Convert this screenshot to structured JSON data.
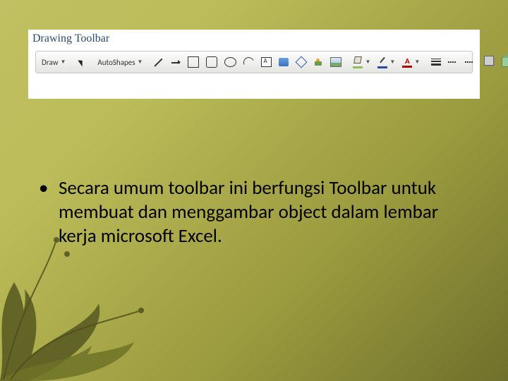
{
  "panel": {
    "title": "Drawing Toolbar"
  },
  "toolbar": {
    "draw_label": "Draw",
    "autoshapes_label": "AutoShapes",
    "icons": {
      "cursor": "select-cursor",
      "line": "line",
      "arrow": "arrow",
      "rect": "rectangle",
      "roundrect": "rounded-rectangle",
      "ellipse": "ellipse",
      "arc": "arc",
      "textbox": "text-box",
      "wordart": "word-art",
      "diagram": "diagram",
      "clipart": "clip-art",
      "picture": "picture",
      "fillcolor": "fill-color",
      "linecolor": "line-color",
      "fontcolor": "font-color",
      "lineweight": "line-weight",
      "dash": "dash-style",
      "arrowstyle": "arrow-style",
      "shadow": "shadow",
      "threeD": "3d"
    },
    "colors": {
      "fill_swatch": "#8fbf5f",
      "line_swatch": "#2b4aa0",
      "font_swatch": "#b00000"
    }
  },
  "bullets": [
    "Secara umum toolbar ini berfungsi Toolbar untuk membuat dan menggambar object dalam lembar kerja microsoft Excel."
  ]
}
